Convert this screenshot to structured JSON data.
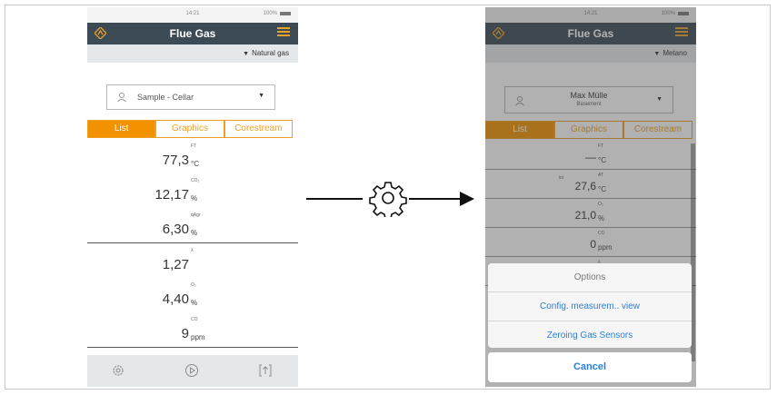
{
  "left_screen": {
    "status_time": "14:21",
    "status_battery": "100%",
    "title": "Flue Gas",
    "fuel": "Natural gas",
    "location": "Sample - Cellar",
    "tabs": [
      "List",
      "Graphics",
      "Corestream"
    ],
    "active_tab": "List",
    "readings": [
      {
        "value": "77,3",
        "param": "FT",
        "unit": "°C"
      },
      {
        "value": "12,17",
        "param": "CO₂",
        "unit": "%"
      },
      {
        "value": "6,30",
        "param": "qAgr",
        "unit": "%"
      },
      {
        "value": "1,27",
        "param": "λ",
        "unit": ""
      },
      {
        "value": "4,40",
        "param": "O₂",
        "unit": "%"
      },
      {
        "value": "9",
        "param": "CO",
        "unit": "ppm"
      }
    ],
    "bottom_icons": [
      "settings-icon",
      "play-icon",
      "export-icon"
    ]
  },
  "right_screen": {
    "status_time": "14:21",
    "status_battery": "100%",
    "title": "Flue Gas",
    "fuel": "Metano",
    "customer": "Max Mülle",
    "location": "Basement",
    "tabs": [
      "List",
      "Graphics",
      "Corestream"
    ],
    "active_tab": "List",
    "readings": [
      {
        "value": "—",
        "param": "FT",
        "unit": "°C",
        "pre": ""
      },
      {
        "value": "27,6",
        "param": "AT",
        "unit": "°C",
        "pre": "int"
      },
      {
        "value": "21,0",
        "param": "O₂",
        "unit": "%",
        "pre": ""
      },
      {
        "value": "0",
        "param": "CO",
        "unit": "ppm",
        "pre": ""
      },
      {
        "value": "—",
        "param": "λ",
        "unit": "",
        "pre": ""
      }
    ],
    "sheet": {
      "header": "Options",
      "options": [
        "Config. measurem.. view",
        "Zeroing Gas Sensors"
      ],
      "cancel": "Cancel"
    }
  },
  "colors": {
    "accent": "#f39200",
    "header_bg": "#3c4a55",
    "link": "#2a7fd6"
  }
}
